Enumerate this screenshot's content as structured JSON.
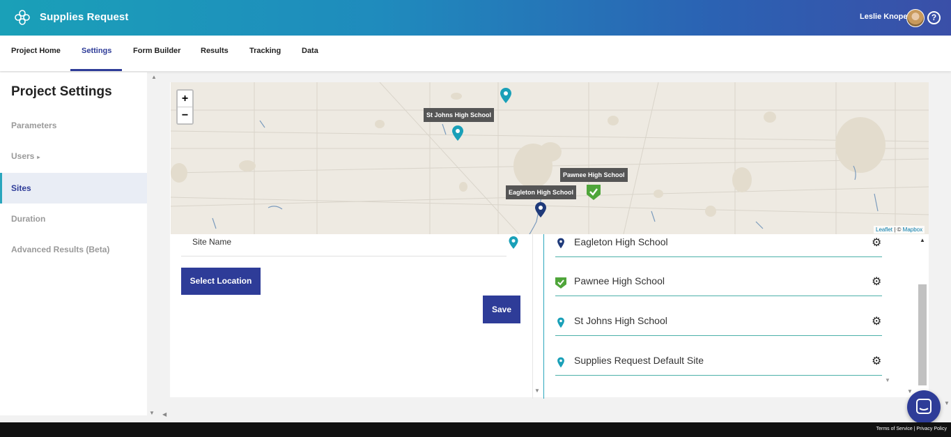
{
  "header": {
    "app_title": "Supplies Request",
    "user_name": "Leslie Knope",
    "logo_icon": "flower-logo-icon",
    "help_icon": "question-circle-icon",
    "help_glyph": "?"
  },
  "tabs": [
    {
      "label": "Project Home"
    },
    {
      "label": "Settings",
      "active": true
    },
    {
      "label": "Form Builder"
    },
    {
      "label": "Results"
    },
    {
      "label": "Tracking"
    },
    {
      "label": "Data"
    }
  ],
  "sidebar": {
    "title": "Project Settings",
    "items": [
      {
        "label": "Parameters"
      },
      {
        "label": "Users",
        "has_submenu": true
      },
      {
        "label": "Sites",
        "active": true
      },
      {
        "label": "Duration"
      },
      {
        "label": "Advanced Results (Beta)"
      }
    ]
  },
  "map": {
    "zoom_in": "+",
    "zoom_out": "−",
    "labels": [
      "St Johns High School",
      "Pawnee High School",
      "Eagleton High School"
    ],
    "attribution_leaflet": "Leaflet",
    "attribution_sep": " | © ",
    "attribution_mapbox": "Mapbox"
  },
  "form": {
    "site_name_label": "Site Name",
    "select_location_label": "Select Location",
    "save_label": "Save"
  },
  "sites": [
    {
      "name": "Eagleton High School",
      "icon": "pin-navy-icon"
    },
    {
      "name": "Pawnee High School",
      "icon": "check-shield-icon"
    },
    {
      "name": "St Johns High School",
      "icon": "pin-teal-icon"
    },
    {
      "name": "Supplies Request Default Site",
      "icon": "pin-teal-icon"
    }
  ],
  "gear_glyph": "⚙",
  "footer": {
    "links": "Terms of Service | Privacy Policy"
  },
  "colors": {
    "brand_primary": "#2e3c98",
    "teal_accent": "#2aa6bd",
    "navy_pin": "#1f3a7a",
    "green_check": "#4fa53a"
  }
}
